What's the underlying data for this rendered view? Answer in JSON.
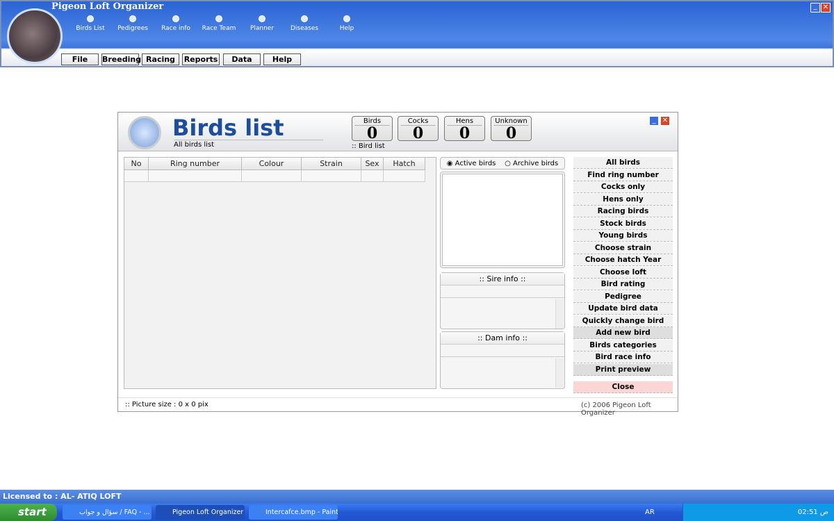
{
  "app": {
    "title": "Pigeon Loft Organizer"
  },
  "nav": [
    "Birds List",
    "Pedigrees",
    "Race info",
    "Race Team",
    "Planner",
    "Diseases",
    "Help"
  ],
  "menu": [
    "File",
    "Breeding",
    "Racing",
    "Reports",
    "Data",
    "Help"
  ],
  "dialog": {
    "title": "Birds list",
    "subtitle": "All birds list",
    "section": ":: Bird list",
    "counters": [
      {
        "label": "Birds",
        "value": "0"
      },
      {
        "label": "Cocks",
        "value": "0"
      },
      {
        "label": "Hens",
        "value": "0"
      },
      {
        "label": "Unknown",
        "value": "0"
      }
    ],
    "columns": [
      "No",
      "Ring number",
      "Colour",
      "Strain",
      "Sex",
      "Hatch date"
    ],
    "filter": {
      "active": "Active birds",
      "archive": "Archive birds",
      "selected": "active"
    },
    "sire": "::   Sire info   ::",
    "dam": "::   Dam info   ::",
    "buttons": [
      "All birds",
      "Find ring number",
      "Cocks only",
      "Hens only",
      "Racing birds",
      "Stock birds",
      "Young birds",
      "Choose strain",
      "Choose hatch Year",
      "Choose loft",
      "Bird rating",
      "Pedigree",
      "Update bird data",
      "Quickly change bird info",
      "Add new bird",
      "Birds categories",
      "Bird race info",
      "Print preview"
    ],
    "close": "Close",
    "picture_size": "::  Picture size : 0 x 0 pix",
    "copyright": "(c) 2006 Pigeon Loft Organizer"
  },
  "status": "Licensed to : AL- ATIQ LOFT",
  "taskbar": {
    "start": "start",
    "tasks": [
      "سؤال و جواب / FAQ - ...",
      "Pigeon Loft Organizer",
      "Intercafce.bmp - Paint"
    ],
    "lang": "AR",
    "clock": "02:51 ص"
  },
  "colors": {
    "accent": "#1d4e9c",
    "close": "#fcd6d6"
  }
}
